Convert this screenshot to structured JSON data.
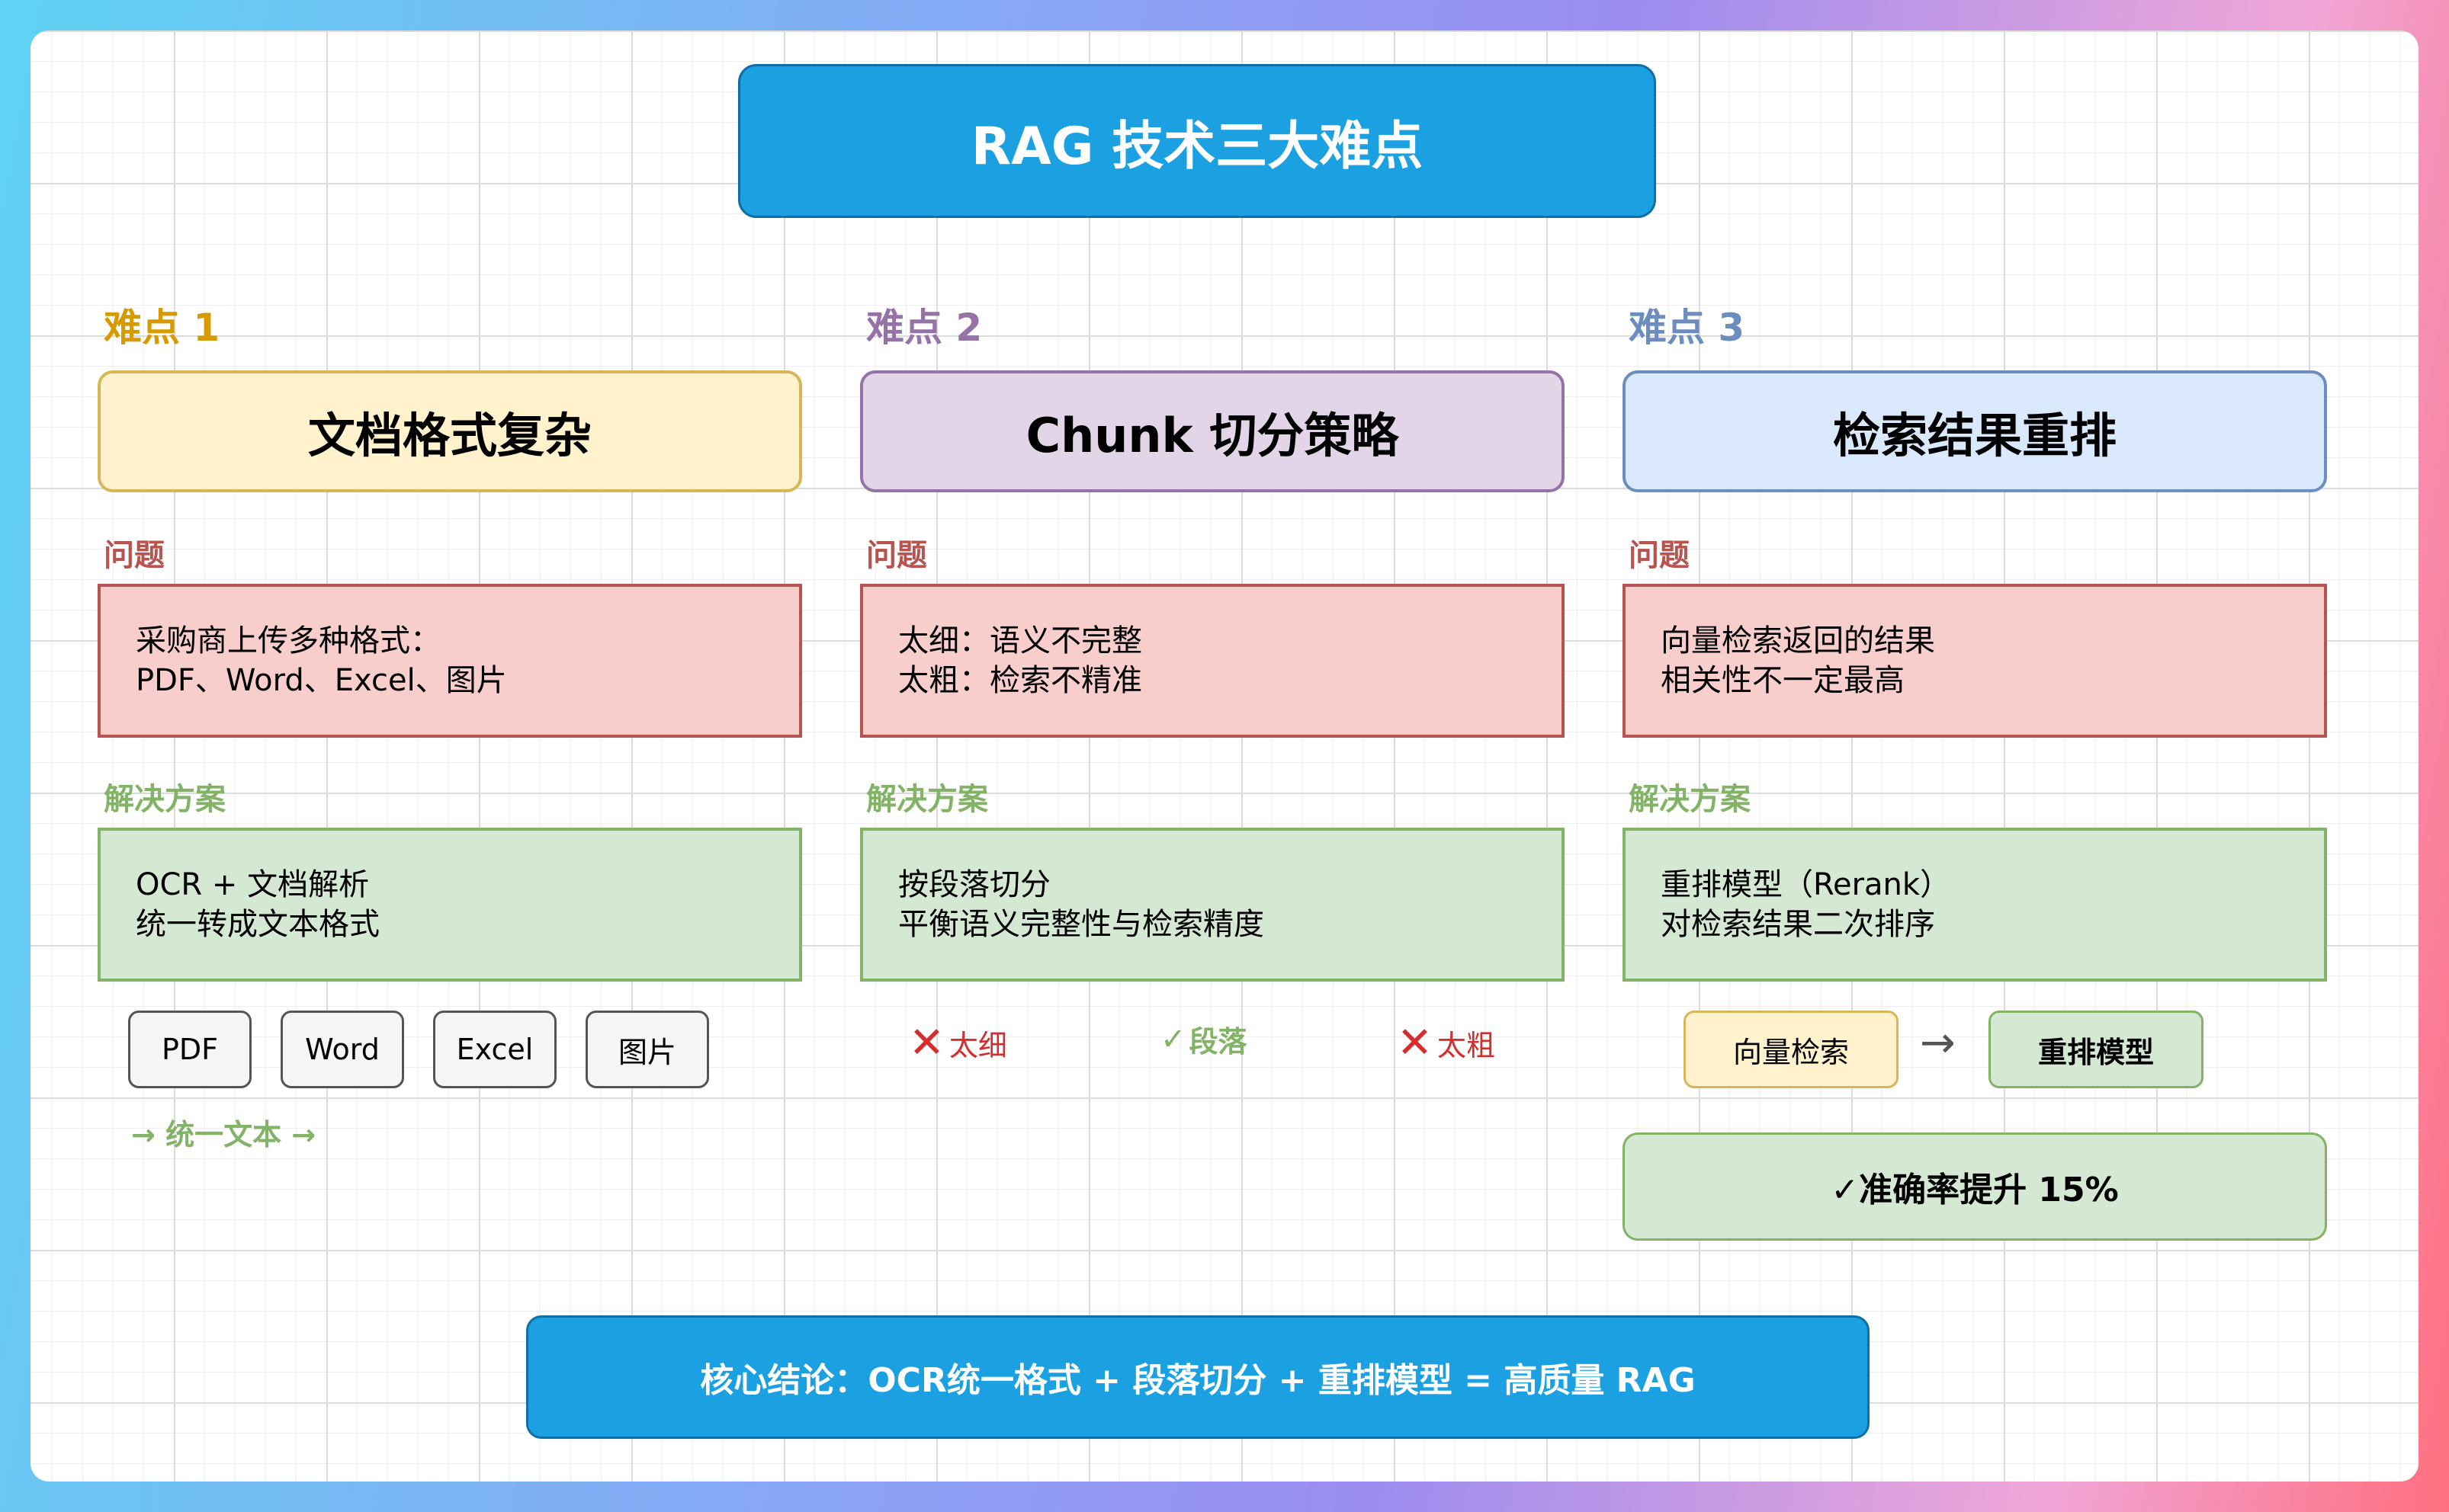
{
  "title": "RAG 技术三大难点",
  "columns": [
    {
      "difficulty_label": "难点 1",
      "difficulty_color": "#d79b00",
      "heading": "文档格式复杂",
      "heading_bg": "#fff2cc",
      "heading_border": "#d6b656",
      "problem_label": "问题",
      "problem_lines": [
        "采购商上传多种格式：",
        "PDF、Word、Excel、图片"
      ],
      "solution_label": "解决方案",
      "solution_lines": [
        "OCR + 文档解析",
        "统一转成文本格式"
      ]
    },
    {
      "difficulty_label": "难点 2",
      "difficulty_color": "#9673a6",
      "heading": "Chunk 切分策略",
      "heading_bg": "#e1d5e7",
      "heading_border": "#9673a6",
      "problem_label": "问题",
      "problem_lines": [
        "太细：语义不完整",
        "太粗：检索不精准"
      ],
      "solution_label": "解决方案",
      "solution_lines": [
        "按段落切分",
        "平衡语义完整性与检索精度"
      ]
    },
    {
      "difficulty_label": "难点 3",
      "difficulty_color": "#6c8ebf",
      "heading": "检索结果重排",
      "heading_bg": "#dae8fc",
      "heading_border": "#6c8ebf",
      "problem_label": "问题",
      "problem_lines": [
        "向量检索返回的结果",
        "相关性不一定最高"
      ],
      "solution_label": "解决方案",
      "solution_lines": [
        "重排模型（Rerank）",
        "对检索结果二次排序"
      ]
    }
  ],
  "formats": [
    "PDF",
    "Word",
    "Excel",
    "图片"
  ],
  "unified_text": "→ 统一文本 →",
  "chunk_options": [
    {
      "mark": "✕",
      "label": "太细",
      "color": "#d32f2f"
    },
    {
      "mark": "✓",
      "label": "段落",
      "color": "#82b366"
    },
    {
      "mark": "✕",
      "label": "太粗",
      "color": "#d32f2f"
    }
  ],
  "rerank_flow": {
    "from": "向量检索",
    "arrow": "→",
    "to": "重排模型"
  },
  "accuracy_text": "✓准确率提升 15%",
  "conclusion": "核心结论：OCR统一格式 + 段落切分 + 重排模型 = 高质量 RAG",
  "colors": {
    "primary": "#1ba1e2",
    "problem_label": "#b85450",
    "solution_label": "#82b366"
  }
}
